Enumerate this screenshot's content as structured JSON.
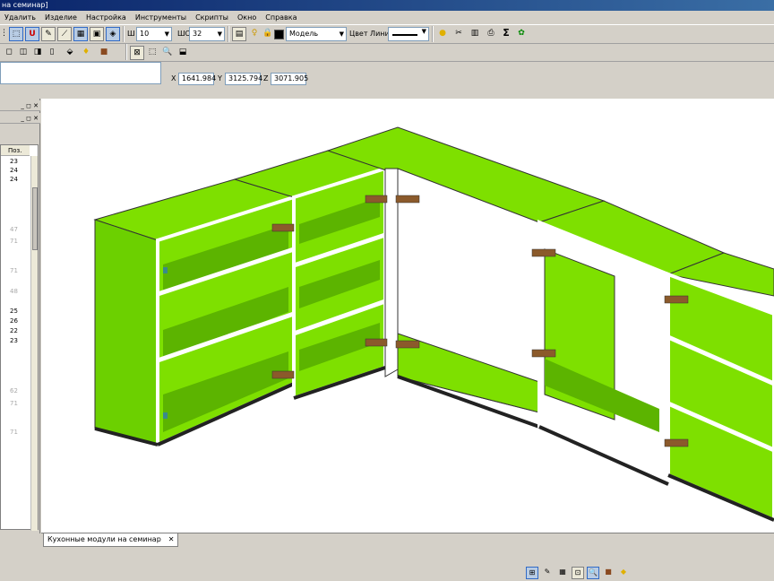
{
  "window": {
    "title": "на семинар]"
  },
  "menu": [
    "Удалить",
    "Изделие",
    "Настройка",
    "Инструменты",
    "Скрипты",
    "Окно",
    "Справка"
  ],
  "toolbar": {
    "width_label": "Ш",
    "width_value": "10",
    "height_label": "ШС",
    "height_value": "32",
    "layer_value": "Модель",
    "line_color_label": "Цвет Линии",
    "sigma": "Σ"
  },
  "coords": {
    "x_label": "X",
    "x_value": "1641.984",
    "y_label": "Y",
    "y_value": "3125.794",
    "z_label": "Z",
    "z_value": "3071.905"
  },
  "panel": {
    "header": "Поз.",
    "numbers": [
      "23",
      "24",
      "24",
      "47",
      "71",
      "71",
      "48",
      "25",
      "26",
      "22",
      "23",
      "62",
      "71",
      "71"
    ],
    "faint": [
      false,
      false,
      false,
      true,
      true,
      true,
      true,
      false,
      false,
      false,
      false,
      true,
      true,
      true
    ]
  },
  "doc_tab": {
    "label": "Кухонные модули на семинар",
    "close": "✕"
  },
  "colors": {
    "panel_green": "#7ee000",
    "panel_green_dark": "#5fb800",
    "edge_white": "#ffffff",
    "accent": "#0a246a"
  }
}
